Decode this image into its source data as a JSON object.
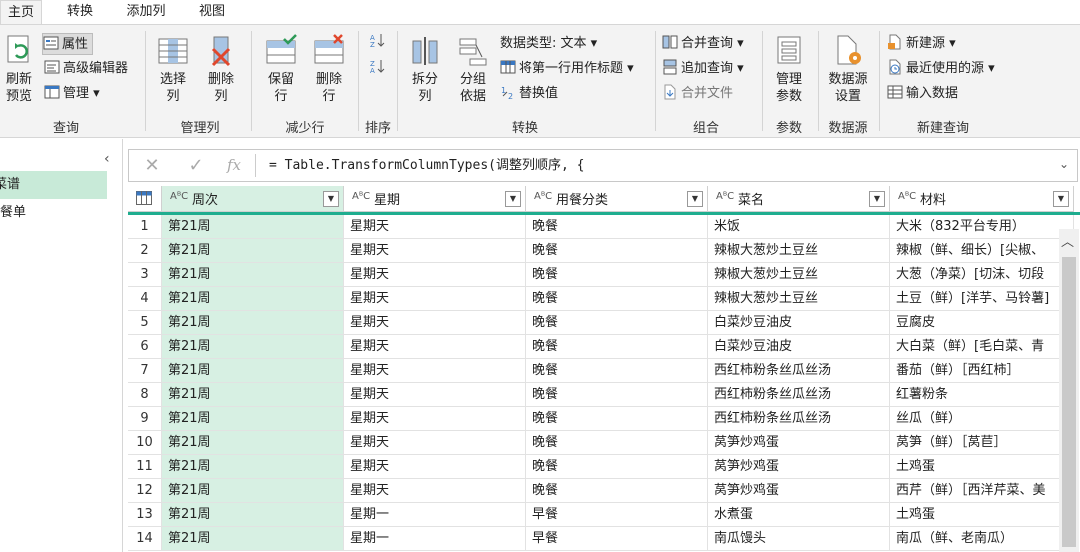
{
  "tabs": [
    "主页",
    "转换",
    "添加列",
    "视图"
  ],
  "ribbon": {
    "refresh": "刷新\n预览",
    "properties": "属性",
    "advanced_editor": "高级编辑器",
    "manage": "管理",
    "group_query": "查询",
    "choose_cols": "选择\n列",
    "remove_cols": "删除\n列",
    "group_manage_cols": "管理列",
    "keep_rows": "保留\n行",
    "remove_rows": "删除\n行",
    "group_reduce_rows": "减少行",
    "group_sort": "排序",
    "split_col": "拆分\n列",
    "group_by": "分组\n依据",
    "data_type": "数据类型: 文本",
    "first_row_header": "将第一行用作标题",
    "replace_values": "替换值",
    "group_transform": "转换",
    "merge_queries": "合并查询",
    "append_queries": "追加查询",
    "combine_files": "合并文件",
    "group_combine": "组合",
    "manage_params": "管理\n参数",
    "group_params": "参数",
    "datasource_settings": "数据源\n设置",
    "group_datasource": "数据源",
    "new_source": "新建源",
    "recent_sources": "最近使用的源",
    "enter_data": "输入数据",
    "group_new_query": "新建查询"
  },
  "left_panel": {
    "items": [
      "菜谱",
      "用餐单"
    ]
  },
  "formula_bar": {
    "formula": "= Table.TransformColumnTypes(调整列顺序, {"
  },
  "columns": [
    {
      "type": "AᴮC",
      "name": "周次"
    },
    {
      "type": "AᴮC",
      "name": "星期"
    },
    {
      "type": "AᴮC",
      "name": "用餐分类"
    },
    {
      "type": "AᴮC",
      "name": "菜名"
    },
    {
      "type": "AᴮC",
      "name": "材料"
    }
  ],
  "rows": [
    [
      "1",
      "第21周",
      "星期天",
      "晚餐",
      "米饭",
      "大米（832平台专用）"
    ],
    [
      "2",
      "第21周",
      "星期天",
      "晚餐",
      "辣椒大葱炒土豆丝",
      "辣椒（鲜、细长）[尖椒、"
    ],
    [
      "3",
      "第21周",
      "星期天",
      "晚餐",
      "辣椒大葱炒土豆丝",
      "大葱（净菜）[切沫、切段"
    ],
    [
      "4",
      "第21周",
      "星期天",
      "晚餐",
      "辣椒大葱炒土豆丝",
      "土豆（鲜）[洋芋、马铃薯]"
    ],
    [
      "5",
      "第21周",
      "星期天",
      "晚餐",
      "白菜炒豆油皮",
      "豆腐皮"
    ],
    [
      "6",
      "第21周",
      "星期天",
      "晚餐",
      "白菜炒豆油皮",
      "大白菜（鲜）[毛白菜、青"
    ],
    [
      "7",
      "第21周",
      "星期天",
      "晚餐",
      "西红柿粉条丝瓜丝汤",
      "番茄（鲜）［西红柿］"
    ],
    [
      "8",
      "第21周",
      "星期天",
      "晚餐",
      "西红柿粉条丝瓜丝汤",
      "红薯粉条"
    ],
    [
      "9",
      "第21周",
      "星期天",
      "晚餐",
      "西红柿粉条丝瓜丝汤",
      "丝瓜（鲜）"
    ],
    [
      "10",
      "第21周",
      "星期天",
      "晚餐",
      "莴笋炒鸡蛋",
      "莴笋（鲜）［莴苣］"
    ],
    [
      "11",
      "第21周",
      "星期天",
      "晚餐",
      "莴笋炒鸡蛋",
      "土鸡蛋"
    ],
    [
      "12",
      "第21周",
      "星期天",
      "晚餐",
      "莴笋炒鸡蛋",
      "西芹（鲜）［西洋芹菜、美"
    ],
    [
      "13",
      "第21周",
      "星期一",
      "早餐",
      "水煮蛋",
      "土鸡蛋"
    ],
    [
      "14",
      "第21周",
      "星期一",
      "早餐",
      "南瓜馒头",
      "南瓜（鲜、老南瓜）"
    ]
  ]
}
